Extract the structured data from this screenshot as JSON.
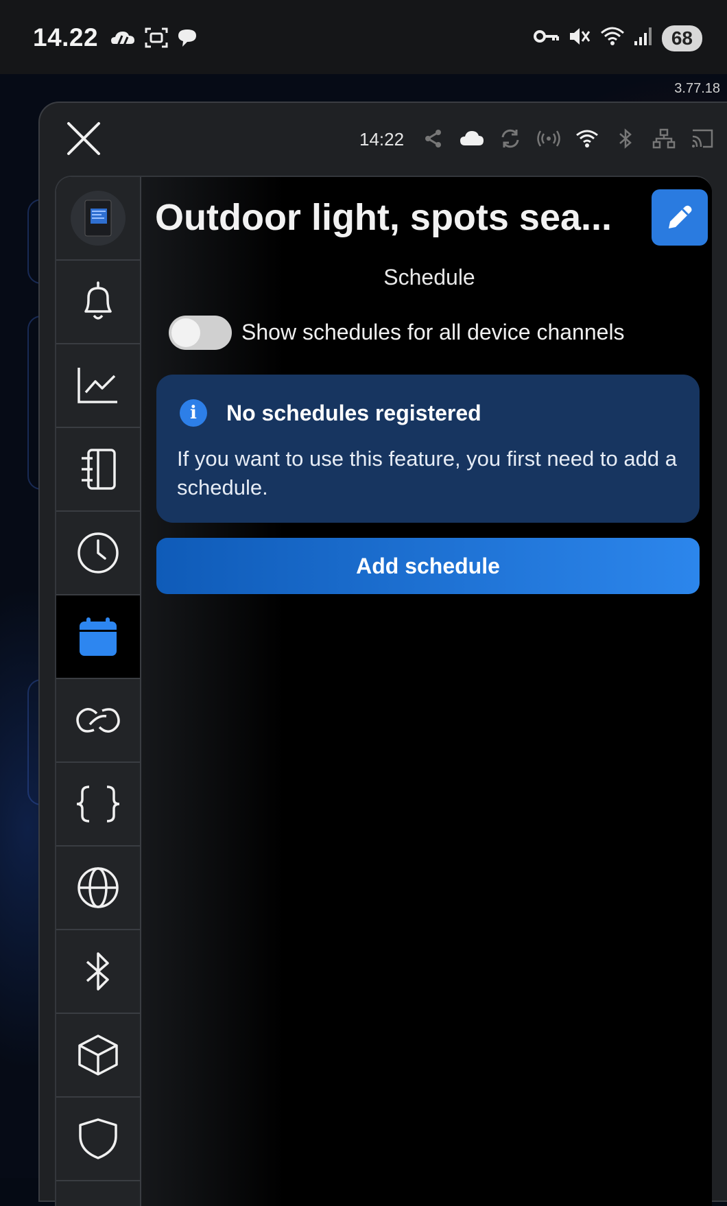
{
  "status_bar": {
    "time": "14.22",
    "battery": "68",
    "left_icons": [
      "weather-icon",
      "screenshot-icon",
      "chat-icon"
    ],
    "right_icons": [
      "key-icon",
      "mute-icon",
      "wifi-icon",
      "signal-icon"
    ]
  },
  "app_version": "3.77.18",
  "top_bar": {
    "time": "14:22",
    "icons": [
      "share-icon",
      "cloud-icon",
      "sync-icon",
      "broadcast-icon",
      "wifi-icon",
      "bluetooth-icon",
      "network-icon",
      "cast-icon"
    ]
  },
  "sidebar": {
    "items": [
      {
        "name": "device-thumbnail",
        "active": false
      },
      {
        "name": "bell-icon",
        "active": false
      },
      {
        "name": "chart-icon",
        "active": false
      },
      {
        "name": "notebook-icon",
        "active": false
      },
      {
        "name": "clock-icon",
        "active": false
      },
      {
        "name": "calendar-icon",
        "active": true
      },
      {
        "name": "link-icon",
        "active": false
      },
      {
        "name": "braces-icon",
        "active": false
      },
      {
        "name": "globe-icon",
        "active": false
      },
      {
        "name": "bluetooth-icon",
        "active": false
      },
      {
        "name": "cube-icon",
        "active": false
      },
      {
        "name": "shield-icon",
        "active": false
      }
    ]
  },
  "main": {
    "title": "Outdoor light, spots sea...",
    "subtitle": "Schedule",
    "toggle_label": "Show schedules for all device channels",
    "toggle_on": false,
    "info_title": "No schedules registered",
    "info_text": "If you want to use this feature, you first need to add a schedule.",
    "add_button": "Add schedule"
  },
  "colors": {
    "accent": "#2a7be0",
    "info_bg": "#173560",
    "active_icon": "#2d86f0"
  }
}
